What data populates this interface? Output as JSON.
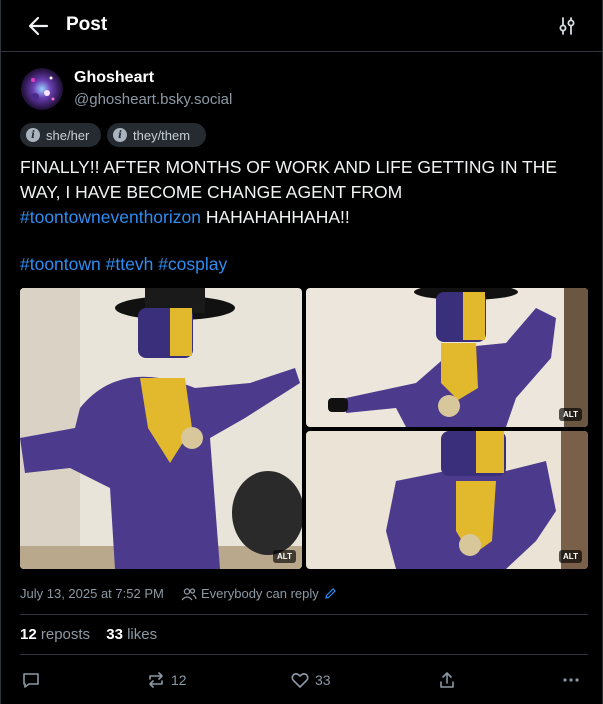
{
  "header": {
    "title": "Post"
  },
  "author": {
    "name": "Ghosheart",
    "handle": "@ghosheart.bsky.social"
  },
  "pronouns": [
    "she/her",
    "they/them"
  ],
  "post": {
    "line1": "FINALLY!! AFTER MONTHS OF WORK AND LIFE GETTING IN THE WAY, I HAVE BECOME CHANGE AGENT FROM ",
    "link1": "#toontowneventhorizon",
    "line1_end": " HAHAHAHHAHA!!",
    "tag1": "#toontown",
    "tag2": "#ttevh",
    "tag3": "#cosplay"
  },
  "images": [
    {
      "alt_badge": "ALT"
    },
    {
      "alt_badge": "ALT"
    },
    {
      "alt_badge": "ALT"
    }
  ],
  "meta": {
    "date": "July 13, 2025 at 7:52 PM",
    "reply_setting": "Everybody can reply"
  },
  "stats": {
    "reposts_count": "12",
    "reposts_label": "reposts",
    "likes_count": "33",
    "likes_label": "likes"
  },
  "actions": {
    "repost_count": "12",
    "like_count": "33"
  },
  "colors": {
    "link": "#2e8cf2",
    "muted": "#8c99a5",
    "background": "#000000"
  }
}
